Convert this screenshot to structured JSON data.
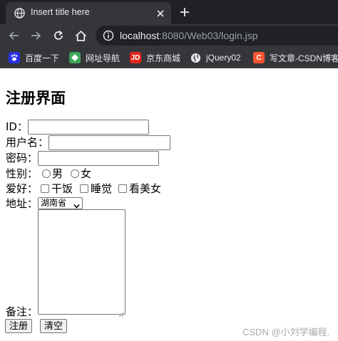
{
  "browser": {
    "tab_title": "Insert title here",
    "url_host": "localhost",
    "url_rest": ":8080/Web03/login.jsp",
    "bookmarks": [
      {
        "label": "百度一下",
        "icon": "baidu-paw-icon",
        "color": "#2932e1"
      },
      {
        "label": "网址导航",
        "icon": "360-navigation-icon",
        "color": "#3aa757"
      },
      {
        "label": "京东商城",
        "icon": "jd-logo-icon",
        "color": "#e1251b",
        "glyph": "JD"
      },
      {
        "label": "jQuery02",
        "icon": "globe-icon",
        "color": "#e8eaed"
      },
      {
        "label": "写文章-CSDN博客",
        "icon": "csdn-logo-icon",
        "color": "#fc5531",
        "glyph": "C"
      }
    ],
    "colors": {
      "tabstrip": "#202124",
      "toolbar": "#35363a",
      "text": "#e8eaed",
      "muted": "#9aa0a6"
    }
  },
  "form": {
    "title": "注册界面",
    "id_label": "ID：",
    "username_label": "用户名：",
    "password_label": "密码：",
    "gender_label": "性别：",
    "gender_options": [
      "男",
      "女"
    ],
    "hobby_label": "爱好：",
    "hobby_options": [
      "干饭",
      "睡觉",
      "看美女"
    ],
    "address_label": "地址：",
    "address_selected": "湖南省",
    "remark_label": "备注：",
    "submit_label": "注册",
    "reset_label": "清空"
  },
  "watermark": "CSDN @小刘学编程."
}
